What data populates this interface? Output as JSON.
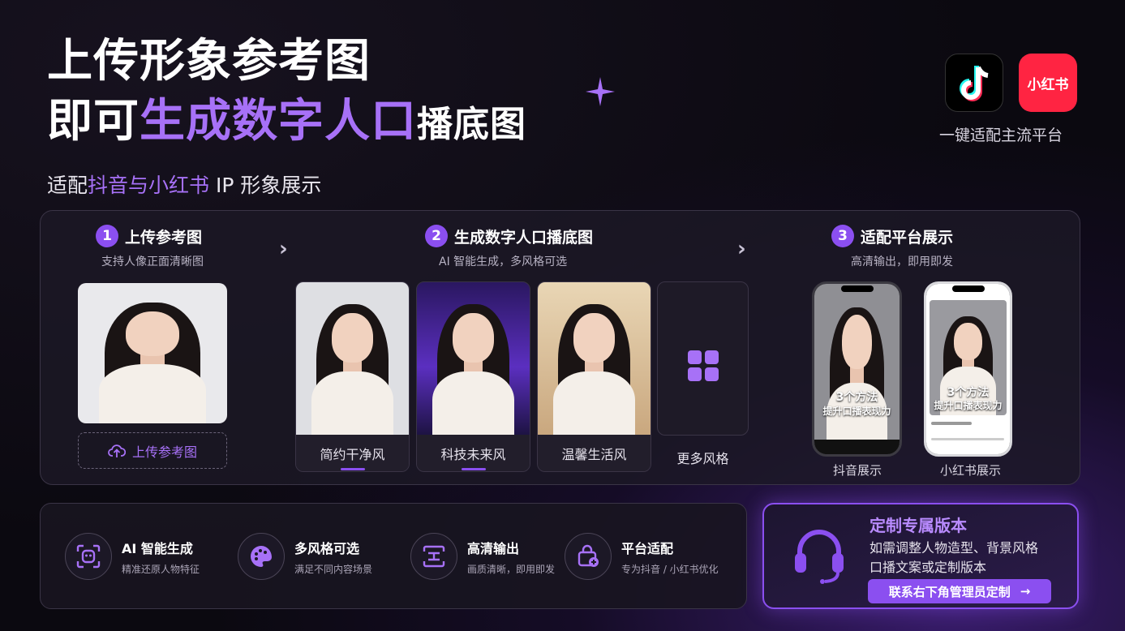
{
  "headline": {
    "line1": "上传形象参考图",
    "line2_white": "即可",
    "line2_purple": "生成数字人口",
    "line2_small": "播底图"
  },
  "subtitle": {
    "prefix": "适配",
    "highlight": "抖音与小红书",
    "suffix": " IP 形象展示"
  },
  "platforms": {
    "xhs_logo_text": "小红书",
    "caption": "一键适配主流平台"
  },
  "steps": [
    {
      "num": "1",
      "title": "上传参考图",
      "sub": "支持人像正面清晰图"
    },
    {
      "num": "2",
      "title": "生成数字人口播底图",
      "sub": "AI 智能生成，多风格可选"
    },
    {
      "num": "3",
      "title": "适配平台展示",
      "sub": "高清输出，即用即发"
    }
  ],
  "upload_button": "上传参考图",
  "styles": [
    "简约干净风",
    "科技未来风",
    "温馨生活风",
    "更多风格"
  ],
  "phones": {
    "overlay_line1": "3个方法",
    "overlay_line2": "提升口播表现力",
    "douyin_label": "抖音展示",
    "xhs_label": "小红书展示"
  },
  "features": [
    {
      "icon": "ai-face-scan-icon",
      "title": "AI 智能生成",
      "sub": "精准还原人物特征"
    },
    {
      "icon": "palette-icon",
      "title": "多风格可选",
      "sub": "满足不同内容场景"
    },
    {
      "icon": "hd-output-icon",
      "title": "高清输出",
      "sub": "画质清晰，即用即发"
    },
    {
      "icon": "platform-adapt-icon",
      "title": "平台适配",
      "sub": "专为抖音 / 小红书优化"
    }
  ],
  "custom": {
    "title": "定制专属版本",
    "desc_line1": "如需调整人物造型、背景风格",
    "desc_line2": "口播文案或定制版本",
    "button": "联系右下角管理员定制",
    "button_arrow": "→"
  },
  "colors": {
    "accent": "#8b4ff0",
    "accent_light": "#a771f7",
    "xhs_red": "#ff2442",
    "background": "#0b0910"
  }
}
